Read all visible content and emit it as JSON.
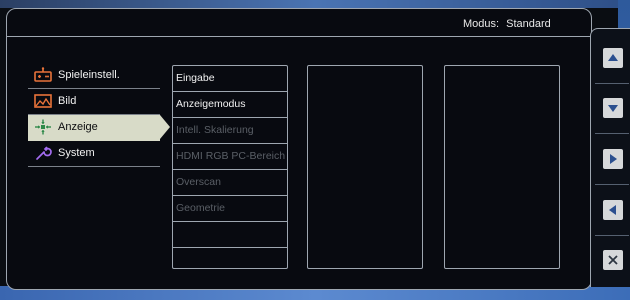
{
  "header": {
    "mode_label": "Modus:",
    "mode_value": "Standard"
  },
  "menu": {
    "items": [
      {
        "label": "Spieleinstell.",
        "icon": "game-controller-icon",
        "active": false
      },
      {
        "label": "Bild",
        "icon": "picture-icon",
        "active": false
      },
      {
        "label": "Anzeige",
        "icon": "display-arrows-icon",
        "active": true
      },
      {
        "label": "System",
        "icon": "wrench-icon",
        "active": false
      }
    ]
  },
  "submenu": {
    "items": [
      {
        "label": "Eingabe",
        "enabled": true
      },
      {
        "label": "Anzeigemodus",
        "enabled": true
      },
      {
        "label": "Intell. Skalierung",
        "enabled": false
      },
      {
        "label": "HDMI RGB PC-Bereich",
        "enabled": false
      },
      {
        "label": "Overscan",
        "enabled": false
      },
      {
        "label": "Geometrie",
        "enabled": false
      },
      {
        "label": "",
        "enabled": false
      },
      {
        "label": "",
        "enabled": false
      }
    ]
  },
  "nav": {
    "buttons": [
      "up-arrow-icon",
      "down-arrow-icon",
      "right-arrow-icon",
      "left-arrow-icon",
      "close-icon"
    ]
  },
  "colors": {
    "active_item_bg": "#d8dbc8",
    "icon_orange": "#e8733a",
    "icon_purple": "#a36cf0",
    "icon_green": "#2f8a4a"
  }
}
